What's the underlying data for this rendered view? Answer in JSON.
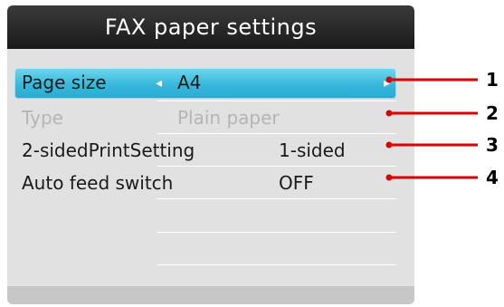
{
  "title": "FAX paper settings",
  "settings": [
    {
      "label": "Page size",
      "value": "A4",
      "state": "selected"
    },
    {
      "label": "Type",
      "value": "Plain paper",
      "state": "disabled"
    },
    {
      "label": "2-sidedPrintSetting",
      "value": "1-sided",
      "state": "normal"
    },
    {
      "label": "Auto feed switch",
      "value": "OFF",
      "state": "normal"
    }
  ],
  "arrows": {
    "left": "◂",
    "right": "▸"
  },
  "callouts": [
    "1",
    "2",
    "3",
    "4"
  ],
  "colors": {
    "highlight": "#36b9dc",
    "title_bar": "#222222",
    "callout_line": "#e00000"
  }
}
